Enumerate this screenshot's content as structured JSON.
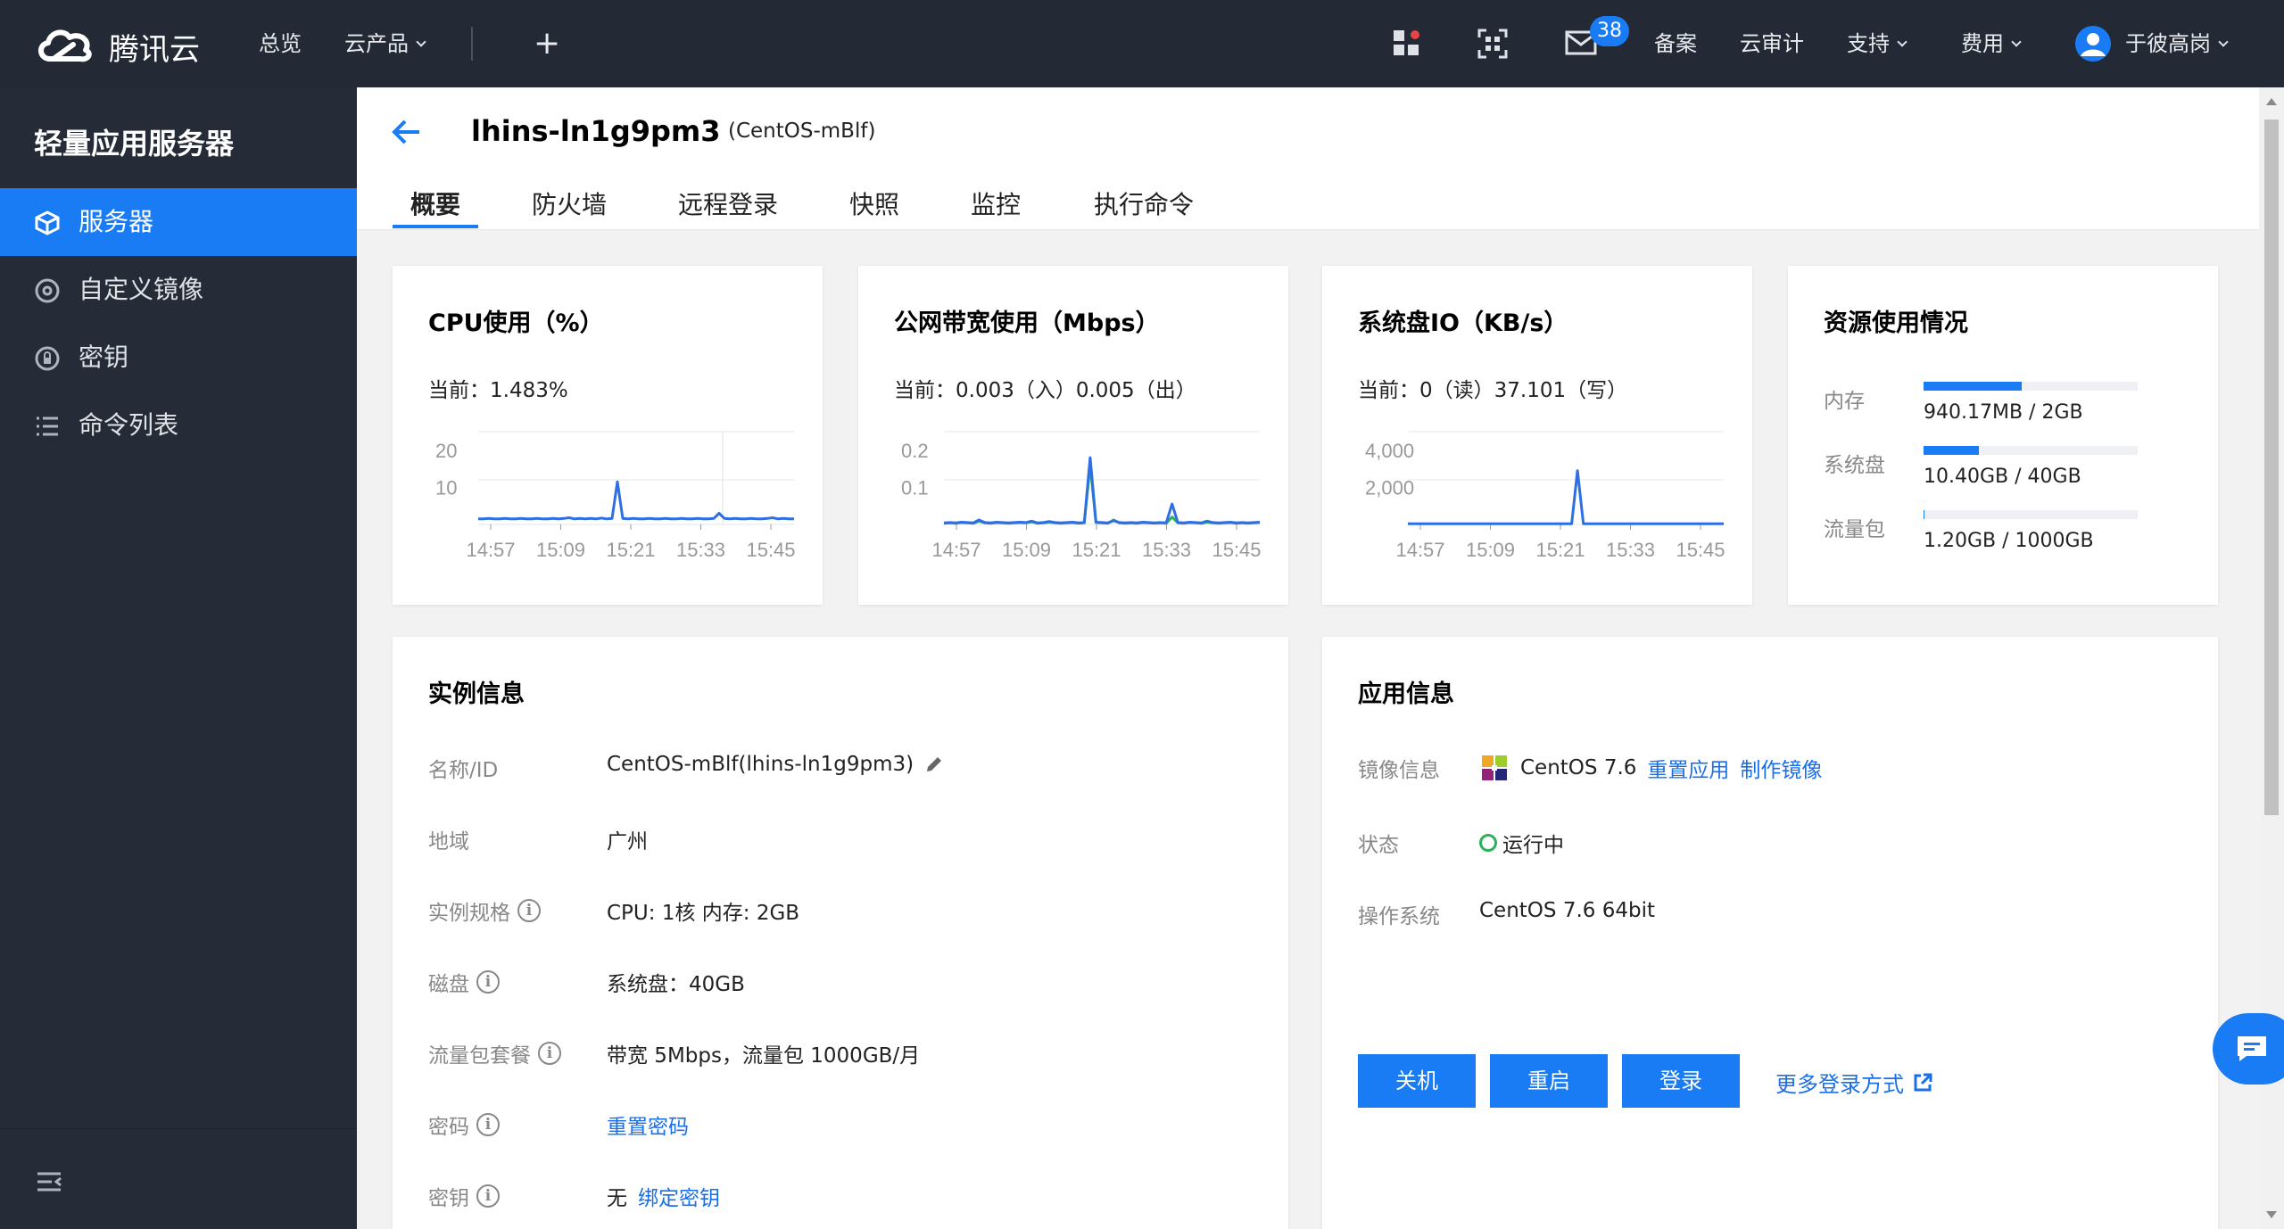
{
  "topbar": {
    "brand": "腾讯云",
    "nav": [
      "总览",
      "云产品"
    ],
    "plus": "+",
    "mail_badge": "38",
    "links": [
      "备案",
      "云审计",
      "支持",
      "费用"
    ],
    "user": "于彼高岗"
  },
  "sidebar": {
    "title": "轻量应用服务器",
    "items": [
      {
        "label": "服务器",
        "icon": "cube-icon",
        "active": true
      },
      {
        "label": "自定义镜像",
        "icon": "disc-icon"
      },
      {
        "label": "密钥",
        "icon": "key-icon"
      },
      {
        "label": "命令列表",
        "icon": "list-icon"
      }
    ]
  },
  "header": {
    "instance_name": "lhins-ln1g9pm3",
    "instance_alias": "(CentOS-mBlf)",
    "tabs": [
      "概要",
      "防火墙",
      "远程登录",
      "快照",
      "监控",
      "执行命令"
    ]
  },
  "metrics": [
    {
      "title": "CPU使用（%）",
      "current": "当前：1.483%",
      "yticks": [
        "20",
        "10"
      ],
      "xticks": [
        "14:57",
        "15:09",
        "15:21",
        "15:33",
        "15:45"
      ]
    },
    {
      "title": "公网带宽使用（Mbps）",
      "current": "当前：0.003（入）0.005（出）",
      "yticks": [
        "0.2",
        "0.1"
      ],
      "xticks": [
        "14:57",
        "15:09",
        "15:21",
        "15:33",
        "15:45"
      ]
    },
    {
      "title": "系统盘IO（KB/s）",
      "current": "当前：0（读）37.101（写）",
      "yticks": [
        "4,000",
        "2,000"
      ],
      "xticks": [
        "14:57",
        "15:09",
        "15:21",
        "15:33",
        "15:45"
      ]
    }
  ],
  "chart_data": [
    {
      "type": "line",
      "ylim": [
        0,
        25
      ],
      "x": [
        "14:57",
        "15:09",
        "15:21",
        "15:33",
        "15:45"
      ],
      "series": [
        {
          "values": [
            1.5,
            1.5,
            1.6,
            1.5,
            1.5,
            1.6,
            1.5,
            1.5,
            1.6,
            1.5,
            1.5,
            1.6,
            1.5,
            1.5,
            1.6,
            1.5,
            1.6,
            1.8,
            1.5,
            1.6,
            1.5,
            1.6,
            1.5,
            1.7,
            1.5,
            1.6,
            11.5,
            1.6,
            1.5,
            1.6,
            1.5,
            1.5,
            1.6,
            1.5,
            1.5,
            1.6,
            1.5,
            1.5,
            1.6,
            1.5,
            1.5,
            1.6,
            1.5,
            1.5,
            1.6,
            3.0,
            1.6,
            1.5,
            1.6,
            1.5,
            1.5,
            1.6,
            1.5,
            1.5,
            1.6,
            1.8,
            1.5,
            1.6,
            1.5,
            1.5
          ]
        }
      ]
    },
    {
      "type": "line",
      "ylim": [
        0,
        0.25
      ],
      "x": [
        "14:57",
        "15:09",
        "15:21",
        "15:33",
        "15:45"
      ],
      "series": [
        {
          "values": [
            0.004,
            0.005,
            0.004,
            0.006,
            0.005,
            0.004,
            0.012,
            0.005,
            0.004,
            0.006,
            0.005,
            0.004,
            0.005,
            0.006,
            0.005,
            0.009,
            0.004,
            0.005,
            0.008,
            0.005,
            0.004,
            0.005,
            0.006,
            0.004,
            0.005,
            0.18,
            0.006,
            0.005,
            0.004,
            0.01,
            0.005,
            0.004,
            0.005,
            0.004,
            0.006,
            0.005,
            0.004,
            0.005,
            0.004,
            0.055,
            0.005,
            0.004,
            0.006,
            0.005,
            0.004,
            0.009,
            0.005,
            0.004,
            0.005,
            0.006,
            0.004,
            0.005,
            0.004,
            0.005,
            0.006
          ]
        },
        {
          "values": [
            0.003,
            0.004,
            0.003,
            0.005,
            0.004,
            0.003,
            0.009,
            0.004,
            0.003,
            0.005,
            0.004,
            0.003,
            0.004,
            0.005,
            0.004,
            0.007,
            0.003,
            0.004,
            0.006,
            0.004,
            0.003,
            0.004,
            0.005,
            0.003,
            0.004,
            0.16,
            0.005,
            0.004,
            0.003,
            0.012,
            0.004,
            0.003,
            0.004,
            0.003,
            0.005,
            0.004,
            0.003,
            0.004,
            0.003,
            0.02,
            0.004,
            0.003,
            0.005,
            0.004,
            0.003,
            0.006,
            0.004,
            0.003,
            0.004,
            0.005,
            0.003,
            0.004,
            0.003,
            0.004,
            0.005
          ]
        }
      ]
    },
    {
      "type": "line",
      "ylim": [
        0,
        5000
      ],
      "x": [
        "14:57",
        "15:09",
        "15:21",
        "15:33",
        "15:45"
      ],
      "series": [
        {
          "values": [
            40,
            38,
            37,
            40,
            36,
            38,
            37,
            39,
            38,
            37,
            40,
            38,
            36,
            37,
            39,
            38,
            37,
            40,
            38,
            37,
            36,
            39,
            38,
            37,
            40,
            38,
            37,
            36,
            39,
            2900,
            38,
            37,
            40,
            38,
            37,
            36,
            39,
            38,
            37,
            40,
            38,
            37,
            36,
            39,
            38,
            37,
            40,
            38,
            37,
            36,
            39,
            38,
            37,
            40,
            38
          ]
        }
      ]
    }
  ],
  "resources": {
    "title": "资源使用情况",
    "items": [
      {
        "label": "内存",
        "value": "940.17MB / 2GB",
        "fraction": 0.46
      },
      {
        "label": "系统盘",
        "value": "10.40GB / 40GB",
        "fraction": 0.26
      },
      {
        "label": "流量包",
        "value": "1.20GB / 1000GB",
        "fraction": 0.0012
      }
    ]
  },
  "instance_info": {
    "title": "实例信息",
    "rows": [
      {
        "label": "名称/ID",
        "value": "CentOS-mBlf(lhins-ln1g9pm3)"
      },
      {
        "label": "地域",
        "value": "广州"
      },
      {
        "label": "实例规格",
        "value": "CPU: 1核 内存: 2GB"
      },
      {
        "label": "磁盘",
        "value": "系统盘：40GB"
      },
      {
        "label": "流量包套餐",
        "value": "带宽 5Mbps，流量包 1000GB/月"
      },
      {
        "label": "密码",
        "link": "重置密码"
      },
      {
        "label": "密钥",
        "value": "无",
        "link": "绑定密钥"
      }
    ]
  },
  "app_info": {
    "title": "应用信息",
    "image_label": "镜像信息",
    "image_name": "CentOS 7.6",
    "reset_app": "重置应用",
    "make_image": "制作镜像",
    "status_label": "状态",
    "status": "运行中",
    "os_label": "操作系统",
    "os": "CentOS 7.6 64bit",
    "buttons": [
      "关机",
      "重启",
      "登录"
    ],
    "more_login": "更多登录方式"
  },
  "colors": {
    "accent": "#1a7cf5",
    "topbar": "#232a36",
    "sidebar": "#262c37",
    "status_green": "#2bb25a",
    "bw_in": "#2bb25a"
  }
}
